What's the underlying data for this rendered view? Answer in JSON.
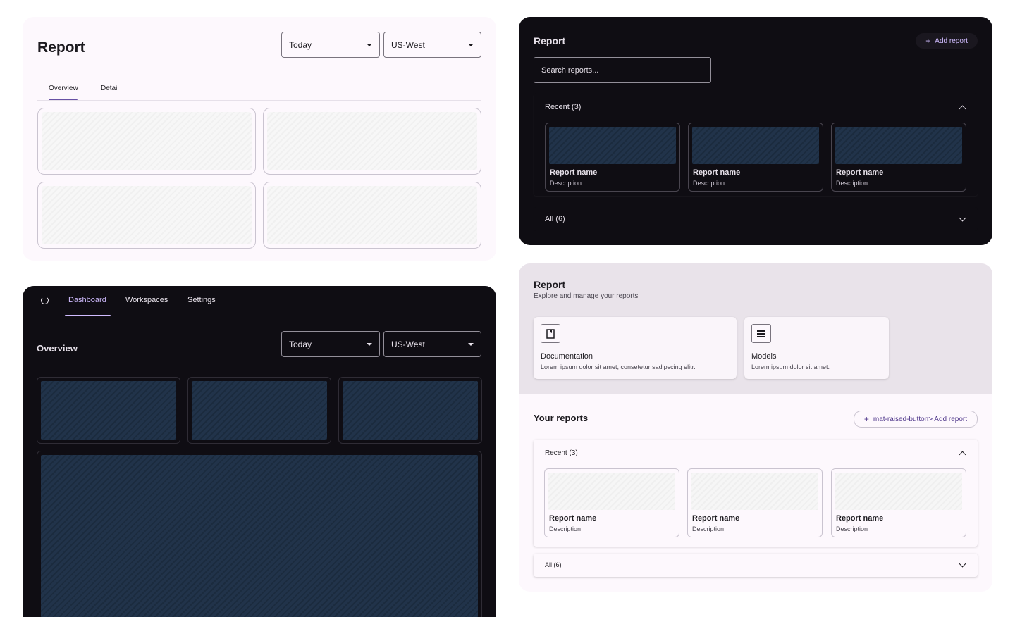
{
  "panel_light": {
    "title": "Report",
    "date_select": "Today",
    "region_select": "US-West",
    "tabs": [
      "Overview",
      "Detail"
    ]
  },
  "panel_dark": {
    "title": "Report",
    "add_button": "Add report",
    "search_placeholder": "Search reports...",
    "recent_label": "Recent (3)",
    "all_label": "All (6)",
    "cards": [
      {
        "name": "Report name",
        "desc": "Description"
      },
      {
        "name": "Report name",
        "desc": "Description"
      },
      {
        "name": "Report name",
        "desc": "Description"
      }
    ]
  },
  "panel_dashboard": {
    "nav": [
      "Dashboard",
      "Workspaces",
      "Settings"
    ],
    "title": "Overview",
    "date_select": "Today",
    "region_select": "US-West"
  },
  "panel_lavender": {
    "title": "Report",
    "subtitle": "Explore and manage your reports",
    "features": [
      {
        "name": "Documentation",
        "desc": "Lorem ipsum dolor sit amet, consetetur sadipscing elitr."
      },
      {
        "name": "Models",
        "desc": "Lorem ipsum dolor sit amet."
      }
    ],
    "section_title": "Your reports",
    "add_button": "mat-raised-button> Add report",
    "recent_label": "Recent (3)",
    "all_label": "All (6)",
    "cards": [
      {
        "name": "Report name",
        "desc": "Description"
      },
      {
        "name": "Report name",
        "desc": "Description"
      },
      {
        "name": "Report name",
        "desc": "Description"
      }
    ]
  },
  "colors": {
    "primary_light": "#6750a4",
    "primary_dark": "#d0bcff",
    "surface_dark": "#0f0d13",
    "surface_light": "#fdf8fd"
  }
}
